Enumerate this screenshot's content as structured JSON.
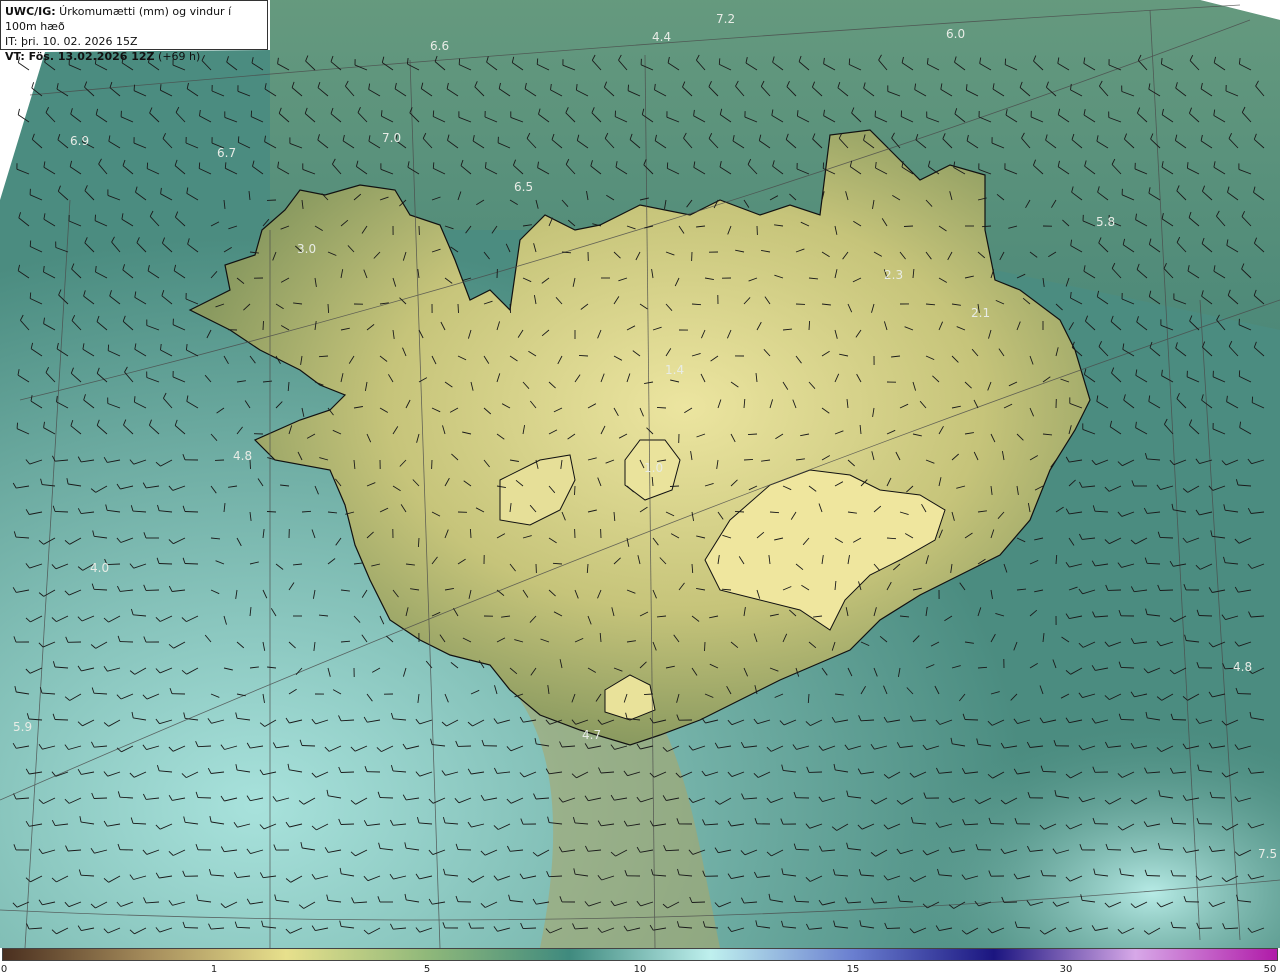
{
  "header": {
    "product": "UWC/IG:",
    "title": " Úrkomumætti (mm) og vindur í 100m hæð",
    "init_label": "IT:",
    "init_time": " þri. 10. 02. 2026 15Z",
    "valid_label": "VT: Fös. 13.02.2026 12Z",
    "valid_lead": " (+69 h)"
  },
  "colors": {
    "ocean_dark": "#3f7d72",
    "ocean_light": "#8fcfc4",
    "land_low": "#8f9a60",
    "land_high": "#e6e08e",
    "coast": "#111111",
    "barb": "#1a1a1a",
    "grid": "#555555",
    "label": "#e8ece6"
  },
  "value_labels": [
    {
      "text": "7.2",
      "id": "v1"
    },
    {
      "text": "4.4",
      "id": "v2"
    },
    {
      "text": "6.0",
      "id": "v3"
    },
    {
      "text": "6.6",
      "id": "v4"
    },
    {
      "text": "6.9",
      "id": "v5"
    },
    {
      "text": "6.7",
      "id": "v6"
    },
    {
      "text": "7.0",
      "id": "v7"
    },
    {
      "text": "6.5",
      "id": "v8"
    },
    {
      "text": "5.8",
      "id": "v9"
    },
    {
      "text": "3.0",
      "id": "v10"
    },
    {
      "text": "2.3",
      "id": "v11"
    },
    {
      "text": "2.1",
      "id": "v12"
    },
    {
      "text": "1.4",
      "id": "v13"
    },
    {
      "text": "4.8",
      "id": "v14"
    },
    {
      "text": "1.0",
      "id": "v15"
    },
    {
      "text": "4.0",
      "id": "v16"
    },
    {
      "text": "4.8",
      "id": "v17"
    },
    {
      "text": "5.9",
      "id": "v18"
    },
    {
      "text": "4.7",
      "id": "v19"
    },
    {
      "text": "7.5",
      "id": "v20"
    }
  ],
  "colorbar": {
    "ticks": [
      "0",
      "1",
      "5",
      "10",
      "15",
      "30",
      "50"
    ],
    "stops": [
      "#4a2f1f",
      "#a38a5a",
      "#e7e08c",
      "#8fb87a",
      "#3f8a7e",
      "#bff0ee",
      "#6a7fd0",
      "#1b1580",
      "#d7a8e8",
      "#b01aa8"
    ]
  }
}
